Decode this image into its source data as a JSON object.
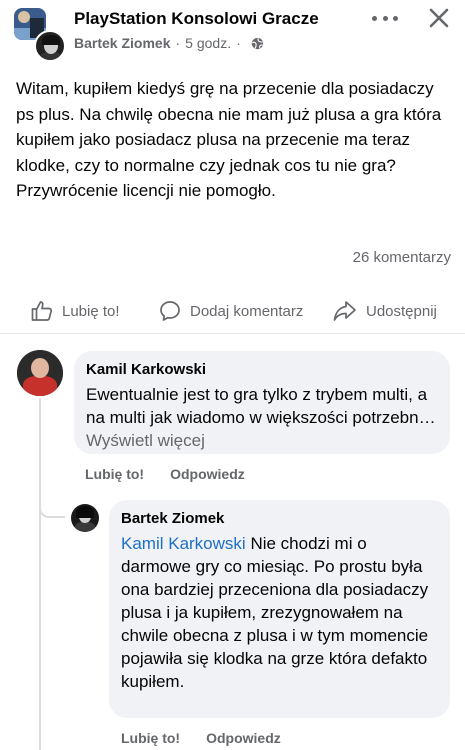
{
  "header": {
    "group_name": "PlayStation Konsolowi Gracze",
    "author": "Bartek Ziomek",
    "separator": "·",
    "time": "5 godz.",
    "separator2": "·"
  },
  "post": {
    "text": "Witam, kupiłem kiedyś grę na przecenie dla posiadaczy ps plus. Na chwilę obecna nie mam już plusa a gra która kupiłem jako posiadacz plusa na przecenie ma teraz klodke, czy to normalne czy jednak cos tu nie gra? Przywrócenie licencji nie pomogło.",
    "comment_count": "26 komentarzy"
  },
  "actions": {
    "like": "Lubię to!",
    "comment": "Dodaj komentarz",
    "share": "Udostępnij"
  },
  "comments": [
    {
      "author": "Kamil Karkowski",
      "text": "Ewentualnie jest to gra tylko z trybem multi, a na multi jak wiadomo w większości potrzebn…",
      "see_more": "Wyświetl więcej",
      "like": "Lubię to!",
      "reply": "Odpowiedz"
    },
    {
      "author": "Bartek Ziomek",
      "mention": "Kamil Karkowski",
      "text": "Nie chodzi mi o darmowe gry co miesiąc. Po prostu była ona bardziej przeceniona dla posiadaczy plusa i ja kupiłem, zrezygnowałem na chwile obecna z plusa i w tym momencie pojawiła się klodka na grze która defakto kupiłem.",
      "like": "Lubię to!",
      "reply": "Odpowiedz"
    }
  ],
  "icons": {
    "globe": "globe-icon",
    "more": "more-options-icon",
    "close": "close-icon",
    "like": "thumbs-up-icon",
    "comment": "comment-bubble-icon",
    "share": "share-arrow-icon"
  },
  "colors": {
    "mention": "#1f6fc5",
    "secondary_text": "#65676b",
    "bubble": "#f0f2f5"
  }
}
